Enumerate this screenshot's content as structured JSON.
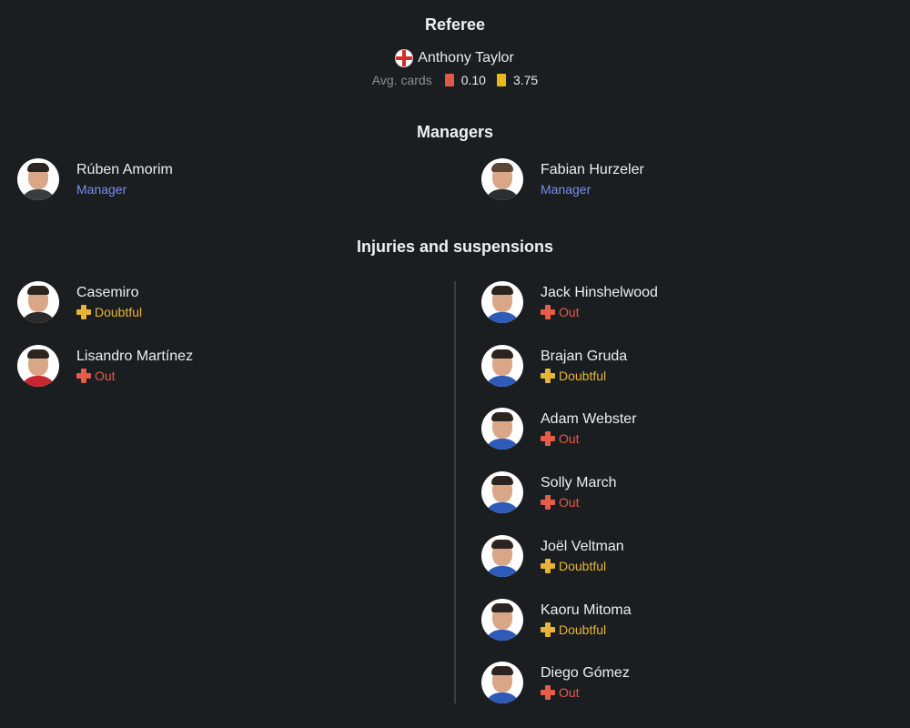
{
  "referee": {
    "title": "Referee",
    "name": "Anthony Taylor",
    "flag_icon": "england-flag-icon",
    "avg_cards_label": "Avg. cards",
    "red_avg": "0.10",
    "yellow_avg": "3.75"
  },
  "managers": {
    "title": "Managers",
    "home": {
      "name": "Rúben Amorim",
      "role": "Manager"
    },
    "away": {
      "name": "Fabian Hurzeler",
      "role": "Manager"
    }
  },
  "injuries": {
    "title": "Injuries and suspensions",
    "home": [
      {
        "name": "Casemiro",
        "status": "Doubtful"
      },
      {
        "name": "Lisandro Martínez",
        "status": "Out"
      }
    ],
    "away": [
      {
        "name": "Jack Hinshelwood",
        "status": "Out"
      },
      {
        "name": "Brajan Gruda",
        "status": "Doubtful"
      },
      {
        "name": "Adam Webster",
        "status": "Out"
      },
      {
        "name": "Solly March",
        "status": "Out"
      },
      {
        "name": "Joël Veltman",
        "status": "Doubtful"
      },
      {
        "name": "Kaoru Mitoma",
        "status": "Doubtful"
      },
      {
        "name": "Diego Gómez",
        "status": "Out"
      }
    ]
  },
  "colors": {
    "background": "#1a1e21",
    "manager_role": "#7b8cf0",
    "doubtful": "#e7b436",
    "out": "#e85b48",
    "red_card": "#e05a4a",
    "yellow_card": "#e8b81c"
  }
}
